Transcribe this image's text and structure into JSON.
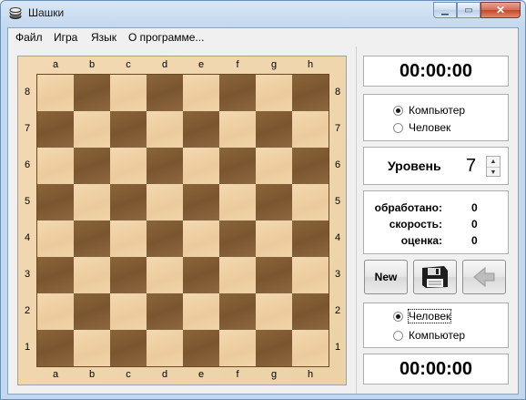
{
  "window": {
    "title": "Шашки"
  },
  "menu": [
    "Файл",
    "Игра",
    "Язык",
    "О программе..."
  ],
  "board": {
    "files": [
      "a",
      "b",
      "c",
      "d",
      "e",
      "f",
      "g",
      "h"
    ],
    "ranks": [
      "8",
      "7",
      "6",
      "5",
      "4",
      "3",
      "2",
      "1"
    ]
  },
  "top_player": {
    "timer": "00:00:00",
    "options": [
      "Компьютер",
      "Человек"
    ],
    "selected": "Компьютер"
  },
  "level": {
    "label": "Уровень",
    "value": "7"
  },
  "stats": [
    {
      "label": "обработано:",
      "value": "0"
    },
    {
      "label": "скорость:",
      "value": "0"
    },
    {
      "label": "оценка:",
      "value": "0"
    }
  ],
  "buttons": {
    "new_label": "New",
    "save_icon": "floppy-disk-icon",
    "undo_icon": "back-arrow-icon"
  },
  "bottom_player": {
    "timer": "00:00:00",
    "options": [
      "Человек",
      "Компьютер"
    ],
    "selected": "Человек"
  },
  "colors": {
    "light_square": "#f0d3a8",
    "dark_square": "#83603a",
    "board_frame": "#efd4a9"
  }
}
